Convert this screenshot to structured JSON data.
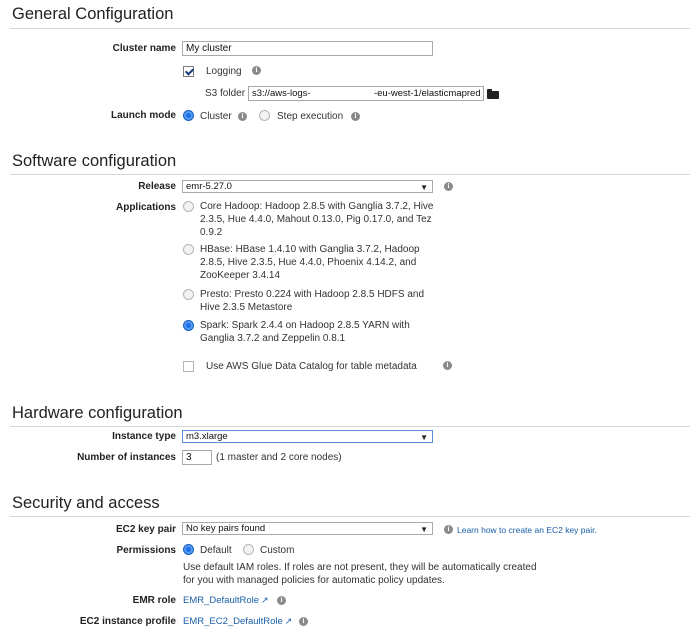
{
  "general": {
    "title": "General Configuration",
    "cluster_name_label": "Cluster name",
    "cluster_name_value": "My cluster",
    "logging_label": "Logging",
    "s3_folder_label": "S3 folder",
    "s3_folder_value": "s3://aws-logs-                        -eu-west-1/elasticmapred",
    "launch_mode_label": "Launch mode",
    "launch_cluster": "Cluster",
    "launch_step": "Step execution"
  },
  "software": {
    "title": "Software configuration",
    "release_label": "Release",
    "release_value": "emr-5.27.0",
    "applications_label": "Applications",
    "app_core": "Core Hadoop: Hadoop 2.8.5 with Ganglia 3.7.2, Hive 2.3.5, Hue 4.4.0, Mahout 0.13.0, Pig 0.17.0, and Tez 0.9.2",
    "app_hbase": "HBase: HBase 1.4.10 with Ganglia 3.7.2, Hadoop 2.8.5, Hive 2.3.5, Hue 4.4.0, Phoenix 4.14.2, and ZooKeeper 3.4.14",
    "app_presto": "Presto: Presto 0.224 with Hadoop 2.8.5 HDFS and Hive 2.3.5 Metastore",
    "app_spark": "Spark: Spark 2.4.4 on Hadoop 2.8.5 YARN with Ganglia 3.7.2 and Zeppelin 0.8.1",
    "glue_label": "Use AWS Glue Data Catalog for table metadata"
  },
  "hardware": {
    "title": "Hardware configuration",
    "instance_type_label": "Instance type",
    "instance_type_value": "m3.xlarge",
    "num_instances_label": "Number of instances",
    "num_instances_value": "3",
    "num_instances_note": "(1 master and 2 core nodes)"
  },
  "security": {
    "title": "Security and access",
    "key_pair_label": "EC2 key pair",
    "key_pair_value": "No key pairs found",
    "key_pair_link": "Learn how to create an EC2 key pair.",
    "permissions_label": "Permissions",
    "perm_default": "Default",
    "perm_custom": "Custom",
    "perm_note": "Use default IAM roles. If roles are not present, they will be automatically created for you with managed policies for automatic policy updates.",
    "emr_role_label": "EMR role",
    "emr_role_link": "EMR_DefaultRole",
    "ec2_profile_label": "EC2 instance profile",
    "ec2_profile_link": "EMR_EC2_DefaultRole"
  },
  "icons": {
    "info": "info-icon",
    "external": "external-link-icon",
    "folder": "folder-open-icon",
    "dropdown": "chevron-down-icon"
  },
  "colors": {
    "accent": "#1a73e8",
    "link": "#1a5ea8"
  }
}
